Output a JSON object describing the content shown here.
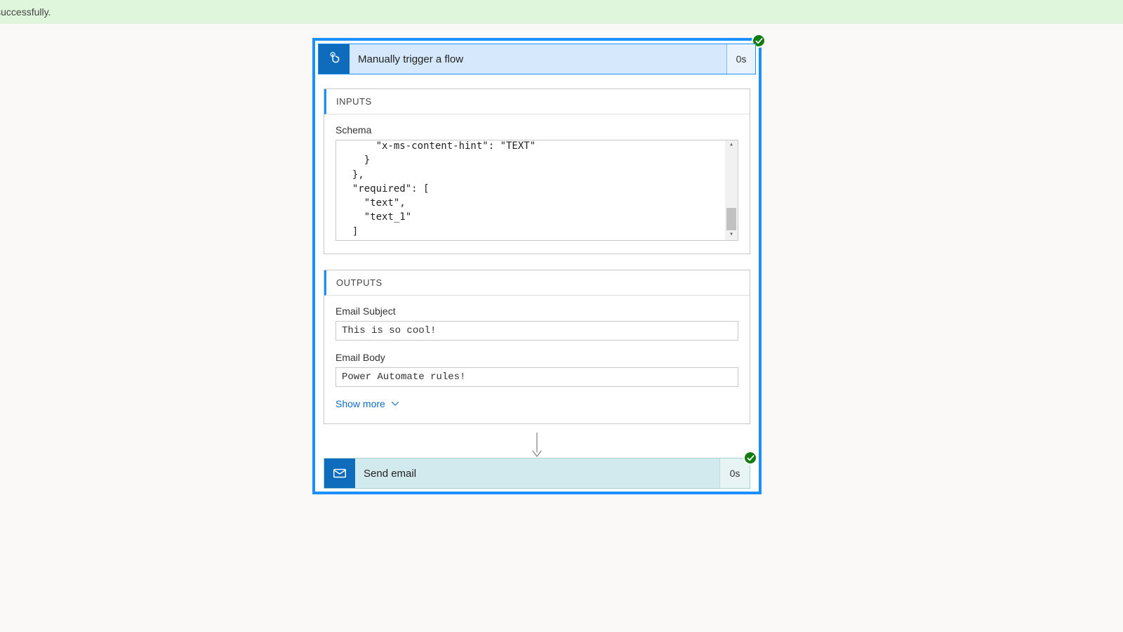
{
  "banner": {
    "text": "ran successfully."
  },
  "trigger": {
    "title": "Manually trigger a flow",
    "duration": "0s",
    "status": "success",
    "inputs": {
      "heading": "INPUTS",
      "schema_label": "Schema",
      "schema_code": "      \"x-ms-content-hint\": \"TEXT\"\n    }\n  },\n  \"required\": [\n    \"text\",\n    \"text_1\"\n  ]\n}"
    },
    "outputs": {
      "heading": "OUTPUTS",
      "fields": [
        {
          "label": "Email Subject",
          "value": "This is so cool!"
        },
        {
          "label": "Email Body",
          "value": "Power Automate rules!"
        }
      ],
      "show_more": "Show more"
    }
  },
  "step2": {
    "title": "Send email",
    "duration": "0s",
    "status": "success"
  }
}
